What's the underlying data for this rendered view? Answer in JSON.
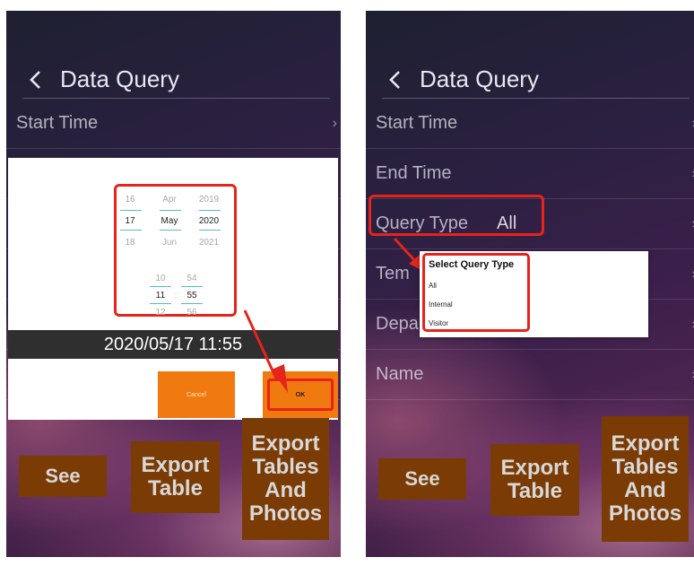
{
  "left": {
    "header": {
      "title": "Data Query"
    },
    "rows": {
      "start_time": "Start Time"
    },
    "date_picker": {
      "days": [
        "16",
        "17",
        "18"
      ],
      "months": [
        "Apr",
        "May",
        "Jun"
      ],
      "years": [
        "2019",
        "2020",
        "2021"
      ],
      "hours": [
        "10",
        "11",
        "12"
      ],
      "minutes": [
        "54",
        "55",
        "56"
      ],
      "separator": ":"
    },
    "selected_datetime": "2020/05/17 11:55",
    "buttons": {
      "cancel": "Cancel",
      "ok": "OK"
    },
    "actions": {
      "see": "See",
      "export_table": "Export Table",
      "export_all": "Export Tables And Photos"
    }
  },
  "right": {
    "header": {
      "title": "Data Query"
    },
    "rows": {
      "start_time": "Start Time",
      "end_time": "End Time",
      "query_type": "Query Type",
      "query_type_value": "All",
      "temp": "Tem",
      "dept": "Depa",
      "name": "Name"
    },
    "popup": {
      "title": "Select Query Type",
      "options": [
        "All",
        "Internal",
        "Visitor"
      ]
    },
    "actions": {
      "see": "See",
      "export_table": "Export Table",
      "export_all": "Export Tables And Photos"
    }
  },
  "colors": {
    "accent_orange": "#f07a10",
    "button_brown": "#7a3b05",
    "highlight_red": "#e6231c",
    "picker_line": "#5ab6d4"
  }
}
